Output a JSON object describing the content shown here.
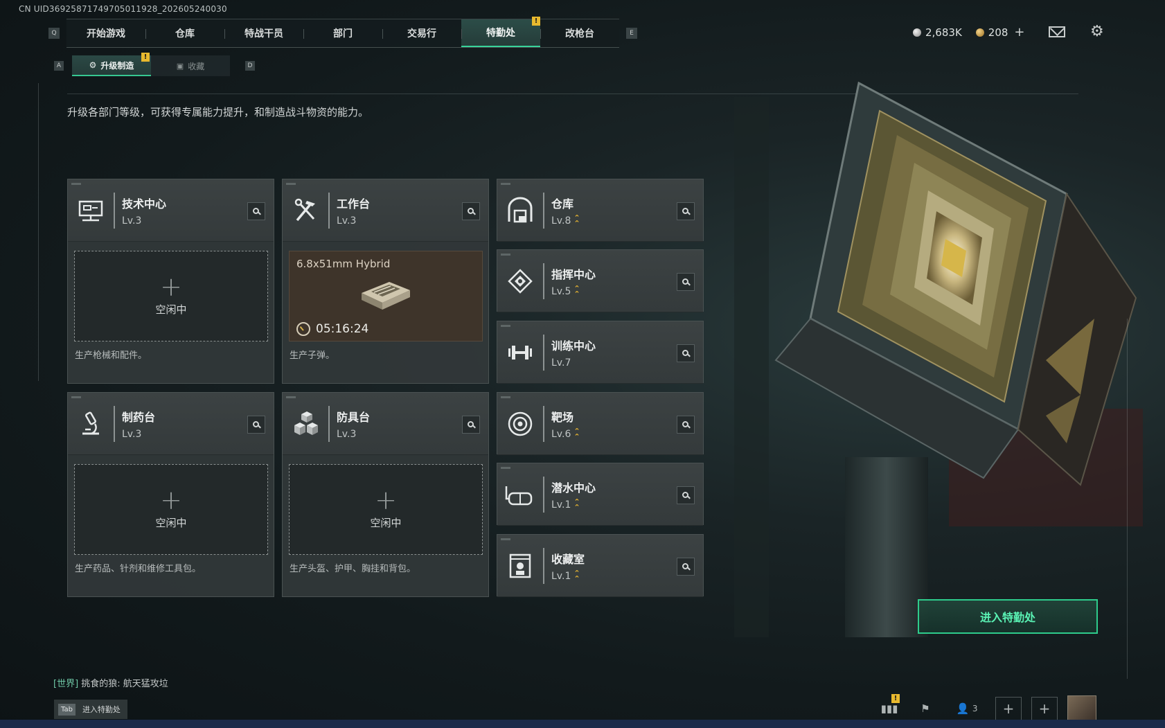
{
  "uid": "CN UID3692587174970501192​8_202605240030",
  "nav": {
    "left_key": "Q",
    "right_key": "E",
    "tabs": [
      {
        "label": "开始游戏",
        "active": false
      },
      {
        "label": "仓库",
        "active": false
      },
      {
        "label": "特战干员",
        "active": false
      },
      {
        "label": "部门",
        "active": false
      },
      {
        "label": "交易行",
        "active": false
      },
      {
        "label": "特勤处",
        "active": true,
        "badge": "!"
      },
      {
        "label": "改枪台",
        "active": false
      }
    ]
  },
  "currency": {
    "silver": "2,683K",
    "gold": "208",
    "plus": "+"
  },
  "subnav": {
    "left_key": "A",
    "right_key": "D",
    "tabs": [
      {
        "label": "升级制造",
        "active": true,
        "badge": "!"
      },
      {
        "label": "收藏",
        "active": false
      }
    ]
  },
  "description": "升级各部门等级，可获得专属能力提升，和制造战斗物资的能力。",
  "workshops": [
    {
      "name": "技术中心",
      "level": "Lv.3",
      "icon": "monitor-icon",
      "status": "空闲中",
      "foot": "生产枪械和配件。"
    },
    {
      "name": "工作台",
      "level": "Lv.3",
      "icon": "tools-icon",
      "producing": {
        "item": "6.8x51mm Hybrid",
        "timer": "05:16:24"
      },
      "foot": "生产子弹。"
    },
    {
      "name": "制药台",
      "level": "Lv.3",
      "icon": "microscope-icon",
      "status": "空闲中",
      "foot": "生产药品、针剂和维修工具包。"
    },
    {
      "name": "防具台",
      "level": "Lv.3",
      "icon": "boxes-icon",
      "status": "空闲中",
      "foot": "生产头盔、护甲、胸挂和背包。"
    }
  ],
  "facilities": [
    {
      "name": "仓库",
      "level": "Lv.8",
      "icon": "warehouse-icon",
      "upgradable": true
    },
    {
      "name": "指挥中心",
      "level": "Lv.5",
      "icon": "command-icon",
      "upgradable": true
    },
    {
      "name": "训练中心",
      "level": "Lv.7",
      "icon": "dumbbell-icon",
      "upgradable": false
    },
    {
      "name": "靶场",
      "level": "Lv.6",
      "icon": "target-icon",
      "upgradable": true
    },
    {
      "name": "潜水中心",
      "level": "Lv.1",
      "icon": "diving-mask-icon",
      "upgradable": true
    },
    {
      "name": "收藏室",
      "level": "Lv.1",
      "icon": "collection-icon",
      "upgradable": true
    }
  ],
  "enter_button": "进入特勤处",
  "chat": {
    "channel": "[世界]",
    "message": "挑食的狼: 航天猛攻垃"
  },
  "tab_hint": {
    "key": "Tab",
    "label": "进入特勤处"
  },
  "bottom_right": {
    "friends_count": "3",
    "badge": "!"
  },
  "colors": {
    "accent": "#36c892",
    "badge": "#e8b92e",
    "upgrade": "#e6b432"
  }
}
